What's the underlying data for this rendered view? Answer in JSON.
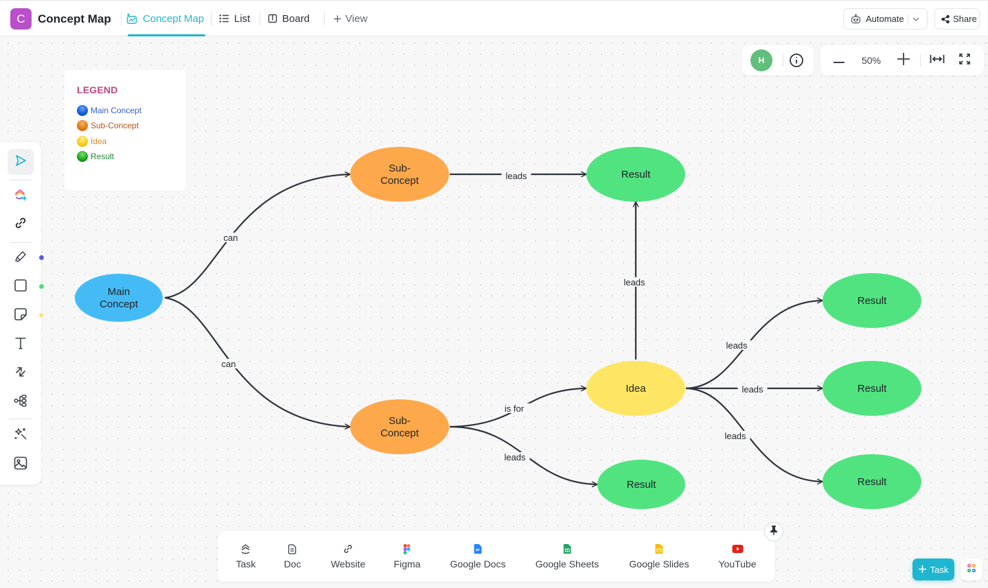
{
  "header": {
    "space_initial": "C",
    "space_title": "Concept Map",
    "tabs": [
      {
        "label": "Concept Map",
        "icon": "concept-map-icon",
        "active": true
      },
      {
        "label": "List",
        "icon": "list-icon",
        "active": false
      },
      {
        "label": "Board",
        "icon": "board-icon",
        "active": false
      }
    ],
    "add_view_label": "View",
    "automate_label": "Automate",
    "share_label": "Share"
  },
  "canvas_controls": {
    "avatar_initial": "H",
    "zoom_level": "50%",
    "info_icon": "info-icon",
    "zoom_out_icon": "minus-icon",
    "zoom_in_icon": "plus-icon",
    "fit_width_icon": "fit-width-icon",
    "fullscreen_icon": "expand-icon"
  },
  "legend": {
    "title": "LEGEND",
    "items": [
      {
        "label": "Main Concept",
        "color": "#0a5bd6",
        "text_color": "#3a5fc8"
      },
      {
        "label": "Sub-Concept",
        "color": "#e3780c",
        "text_color": "#b5541c"
      },
      {
        "label": "Idea",
        "color": "#f6cc0a",
        "text_color": "#d08a22"
      },
      {
        "label": "Result",
        "color": "#16a31b",
        "text_color": "#1e8a36"
      }
    ]
  },
  "toolbar": {
    "tools": [
      "select-icon",
      "clickup-ai-icon",
      "link-icon",
      "pen-icon",
      "rectangle-icon",
      "sticky-note-icon",
      "text-icon",
      "connector-icon",
      "mindmap-icon",
      "magic-wand-icon",
      "image-icon"
    ],
    "color_swatches": [
      "#5b5ce6",
      "#4fdc7b",
      "#f9e58a"
    ]
  },
  "colors": {
    "accent": "#1fb6d1",
    "main_concept": "#45bbf5",
    "sub_concept": "#fda84a",
    "idea": "#fee563",
    "result": "#51e37f",
    "edge": "#2e323a"
  },
  "concept_map": {
    "nodes": [
      {
        "id": "main",
        "type": "main_concept",
        "label": [
          "Main",
          "Concept"
        ]
      },
      {
        "id": "sub1",
        "type": "sub_concept",
        "label": [
          "Sub-",
          "Concept"
        ]
      },
      {
        "id": "sub2",
        "type": "sub_concept",
        "label": [
          "Sub-",
          "Concept"
        ]
      },
      {
        "id": "res1",
        "type": "result",
        "label": [
          "Result"
        ]
      },
      {
        "id": "idea",
        "type": "idea",
        "label": [
          "Idea"
        ]
      },
      {
        "id": "res2",
        "type": "result",
        "label": [
          "Result"
        ]
      },
      {
        "id": "res3",
        "type": "result",
        "label": [
          "Result"
        ]
      },
      {
        "id": "res4",
        "type": "result",
        "label": [
          "Result"
        ]
      },
      {
        "id": "res5",
        "type": "result",
        "label": [
          "Result"
        ]
      }
    ],
    "edges": [
      {
        "from": "main",
        "to": "sub1",
        "label": "can"
      },
      {
        "from": "main",
        "to": "sub2",
        "label": "can"
      },
      {
        "from": "sub1",
        "to": "res1",
        "label": "leads"
      },
      {
        "from": "idea",
        "to": "res1",
        "label": "leads"
      },
      {
        "from": "sub2",
        "to": "idea",
        "label": "is for"
      },
      {
        "from": "sub2",
        "to": "res2",
        "label": "leads"
      },
      {
        "from": "idea",
        "to": "res3",
        "label": "leads"
      },
      {
        "from": "idea",
        "to": "res4",
        "label": "leads"
      },
      {
        "from": "idea",
        "to": "res5",
        "label": "leads"
      }
    ]
  },
  "dock": {
    "items": [
      {
        "label": "Task",
        "icon": "task-icon"
      },
      {
        "label": "Doc",
        "icon": "doc-icon"
      },
      {
        "label": "Website",
        "icon": "link-icon"
      },
      {
        "label": "Figma",
        "icon": "figma-icon"
      },
      {
        "label": "Google Docs",
        "icon": "google-docs-icon"
      },
      {
        "label": "Google Sheets",
        "icon": "google-sheets-icon"
      },
      {
        "label": "Google Slides",
        "icon": "google-slides-icon"
      },
      {
        "label": "YouTube",
        "icon": "youtube-icon"
      }
    ]
  },
  "footer": {
    "task_button_label": "Task"
  }
}
